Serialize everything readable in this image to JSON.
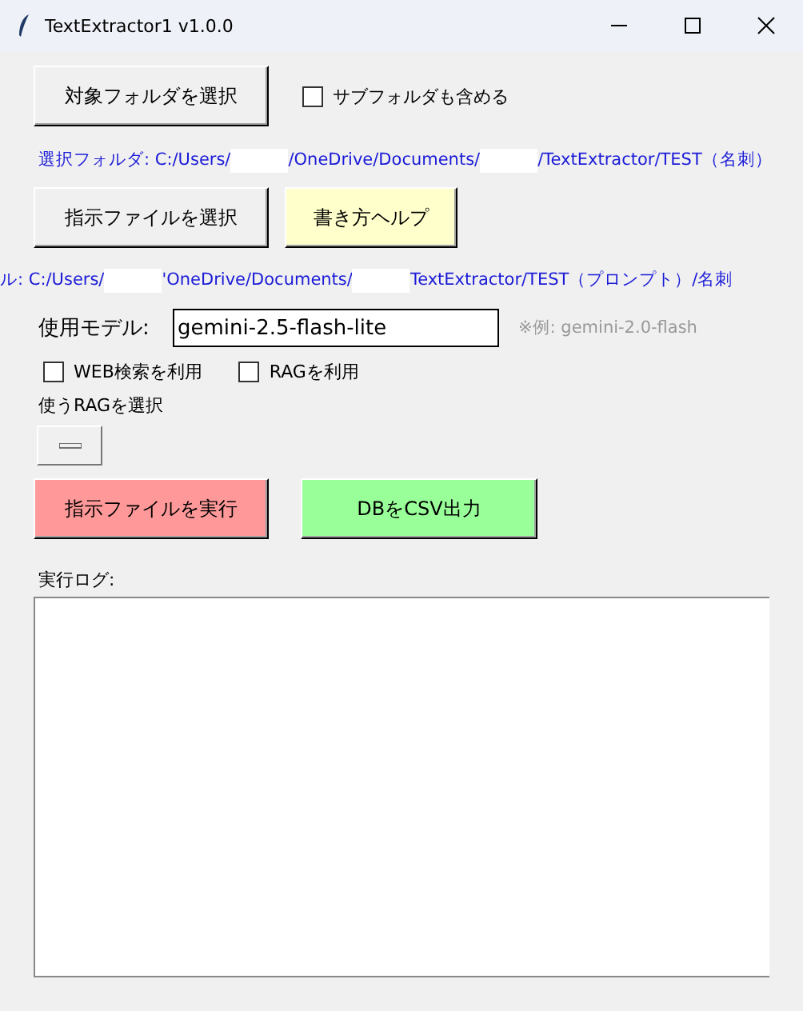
{
  "window": {
    "title": "TextExtractor1 v1.0.0"
  },
  "folder_button": {
    "label": "対象フォルダを選択"
  },
  "subfolder_checkbox": {
    "label": "サブフォルダも含める",
    "checked": false
  },
  "folder_path": [
    "選択フォルダ: C:/Users/",
    "/OneDrive/Documents/",
    "/TextExtractor/TEST（名刺）"
  ],
  "instruction_button": {
    "label": "指示ファイルを選択"
  },
  "help_button": {
    "label": "書き方ヘルプ"
  },
  "instruction_path": [
    "ル: C:/Users/",
    "'OneDrive/Documents/",
    "TextExtractor/TEST（プロンプト）/名刺"
  ],
  "model": {
    "label": "使用モデル:",
    "value": "gemini-2.5-flash-lite",
    "hint": "※例: gemini-2.0-flash"
  },
  "options": [
    {
      "label": "WEB検索を利用",
      "checked": false
    },
    {
      "label": "RAGを利用",
      "checked": false
    }
  ],
  "rag_select": {
    "label": "使うRAGを選択"
  },
  "run_button": {
    "label": "指示ファイルを実行"
  },
  "export_button": {
    "label": "DBをCSV出力"
  },
  "log": {
    "label": "実行ログ:"
  }
}
